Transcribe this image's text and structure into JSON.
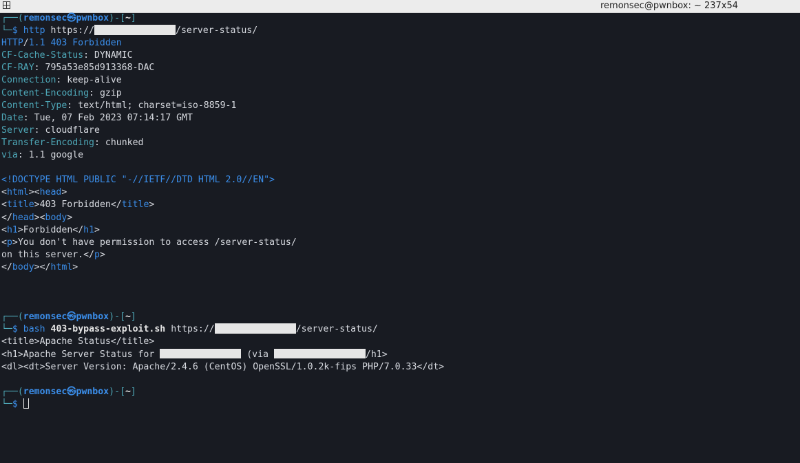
{
  "window": {
    "title": "remonsec@pwnbox: ~ 237x54"
  },
  "prompt": {
    "user": "remonsec",
    "at": "㉿",
    "host": "pwnbox",
    "dir": "~",
    "dollar": "$"
  },
  "command1": {
    "program": "http",
    "url_prefix": "https://",
    "url_suffix": "/server-status/"
  },
  "response": {
    "status_proto": "HTTP",
    "status_rest": "1.1 403 Forbidden",
    "headers": [
      {
        "name": "CF-Cache-Status",
        "value": "DYNAMIC"
      },
      {
        "name": "CF-RAY",
        "value": "795a53e85d913368-DAC"
      },
      {
        "name": "Connection",
        "value": "keep-alive"
      },
      {
        "name": "Content-Encoding",
        "value": "gzip"
      },
      {
        "name": "Content-Type",
        "value": "text/html; charset=iso-8859-1"
      },
      {
        "name": "Date",
        "value": "Tue, 07 Feb 2023 07:14:17 GMT"
      },
      {
        "name": "Server",
        "value": "cloudflare"
      },
      {
        "name": "Transfer-Encoding",
        "value": "chunked"
      },
      {
        "name": "via",
        "value": "1.1 google"
      }
    ],
    "body": {
      "doctype": "<!DOCTYPE HTML PUBLIC \"-//IETF//DTD HTML 2.0//EN\">",
      "title_text": "403 Forbidden",
      "h1_text": "Forbidden",
      "p_text_1": "You don't have permission to access /server-status/",
      "p_text_2": "on this server."
    }
  },
  "command2": {
    "program": "bash",
    "script": "403-bypass-exploit.sh",
    "url_prefix": "https://",
    "url_suffix": "/server-status/"
  },
  "output2": {
    "line1": "<title>Apache Status</title>",
    "line2_prefix": "<h1>Apache Server Status for ",
    "line2_mid": " (via ",
    "line2_suffix": "/h1>",
    "line3": "<dl><dt>Server Version: Apache/2.4.6 (CentOS) OpenSSL/1.0.2k-fips PHP/7.0.33</dt>"
  }
}
